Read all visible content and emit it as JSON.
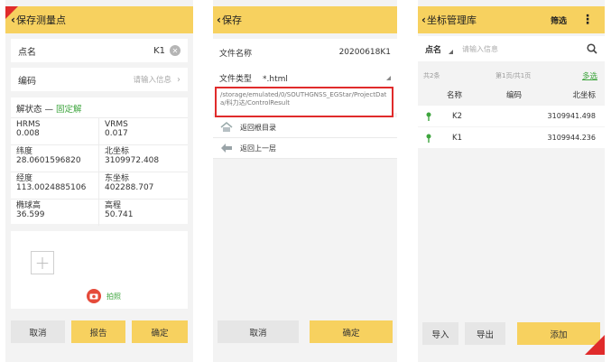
{
  "screen1": {
    "title": "保存测量点",
    "point_name": {
      "label": "点名",
      "value": "K1"
    },
    "code": {
      "label": "编码",
      "placeholder": "请输入信息"
    },
    "status": {
      "label": "解状态 — ",
      "value": "固定解"
    },
    "fields": [
      {
        "label": "HRMS",
        "value": "0.008"
      },
      {
        "label": "VRMS",
        "value": "0.017"
      },
      {
        "label": "纬度",
        "value": "28.0601596820"
      },
      {
        "label": "北坐标",
        "value": "3109972.408"
      },
      {
        "label": "经度",
        "value": "113.0024885106"
      },
      {
        "label": "东坐标",
        "value": "402288.707"
      },
      {
        "label": "椭球高",
        "value": "36.599"
      },
      {
        "label": "高程",
        "value": "50.741"
      }
    ],
    "photo_label": "拍照",
    "buttons": {
      "cancel": "取消",
      "report": "报告",
      "confirm": "确定"
    }
  },
  "screen2": {
    "title": "保存",
    "file_name": {
      "label": "文件名称",
      "value": "20200618K1"
    },
    "file_type": {
      "label": "文件类型",
      "value": "*.html"
    },
    "path": "/storage/emulated/0/SOUTHGNSS_EGStar/ProjectData/科力达/ControlResult",
    "nav_items": [
      {
        "label": "返回根目录",
        "icon": "home-icon"
      },
      {
        "label": "返回上一层",
        "icon": "back-arrow-icon"
      }
    ],
    "buttons": {
      "cancel": "取消",
      "confirm": "确定"
    }
  },
  "screen3": {
    "title": "坐标管理库",
    "filter_label": "筛选",
    "search": {
      "field": "点名",
      "placeholder": "请输入信息"
    },
    "count": "共2条",
    "page": "第1页/共1页",
    "multi_select": "多选",
    "columns": [
      "名称",
      "编码",
      "北坐标"
    ],
    "rows": [
      {
        "name": "K2",
        "code": "",
        "north": "3109941.498"
      },
      {
        "name": "K1",
        "code": "",
        "north": "3109944.236"
      }
    ],
    "buttons": {
      "import": "导入",
      "export": "导出",
      "add": "添加"
    }
  },
  "colors": {
    "accent": "#f7d15f",
    "highlight_border": "#e02b2b",
    "status_green": "#3ea53e"
  }
}
